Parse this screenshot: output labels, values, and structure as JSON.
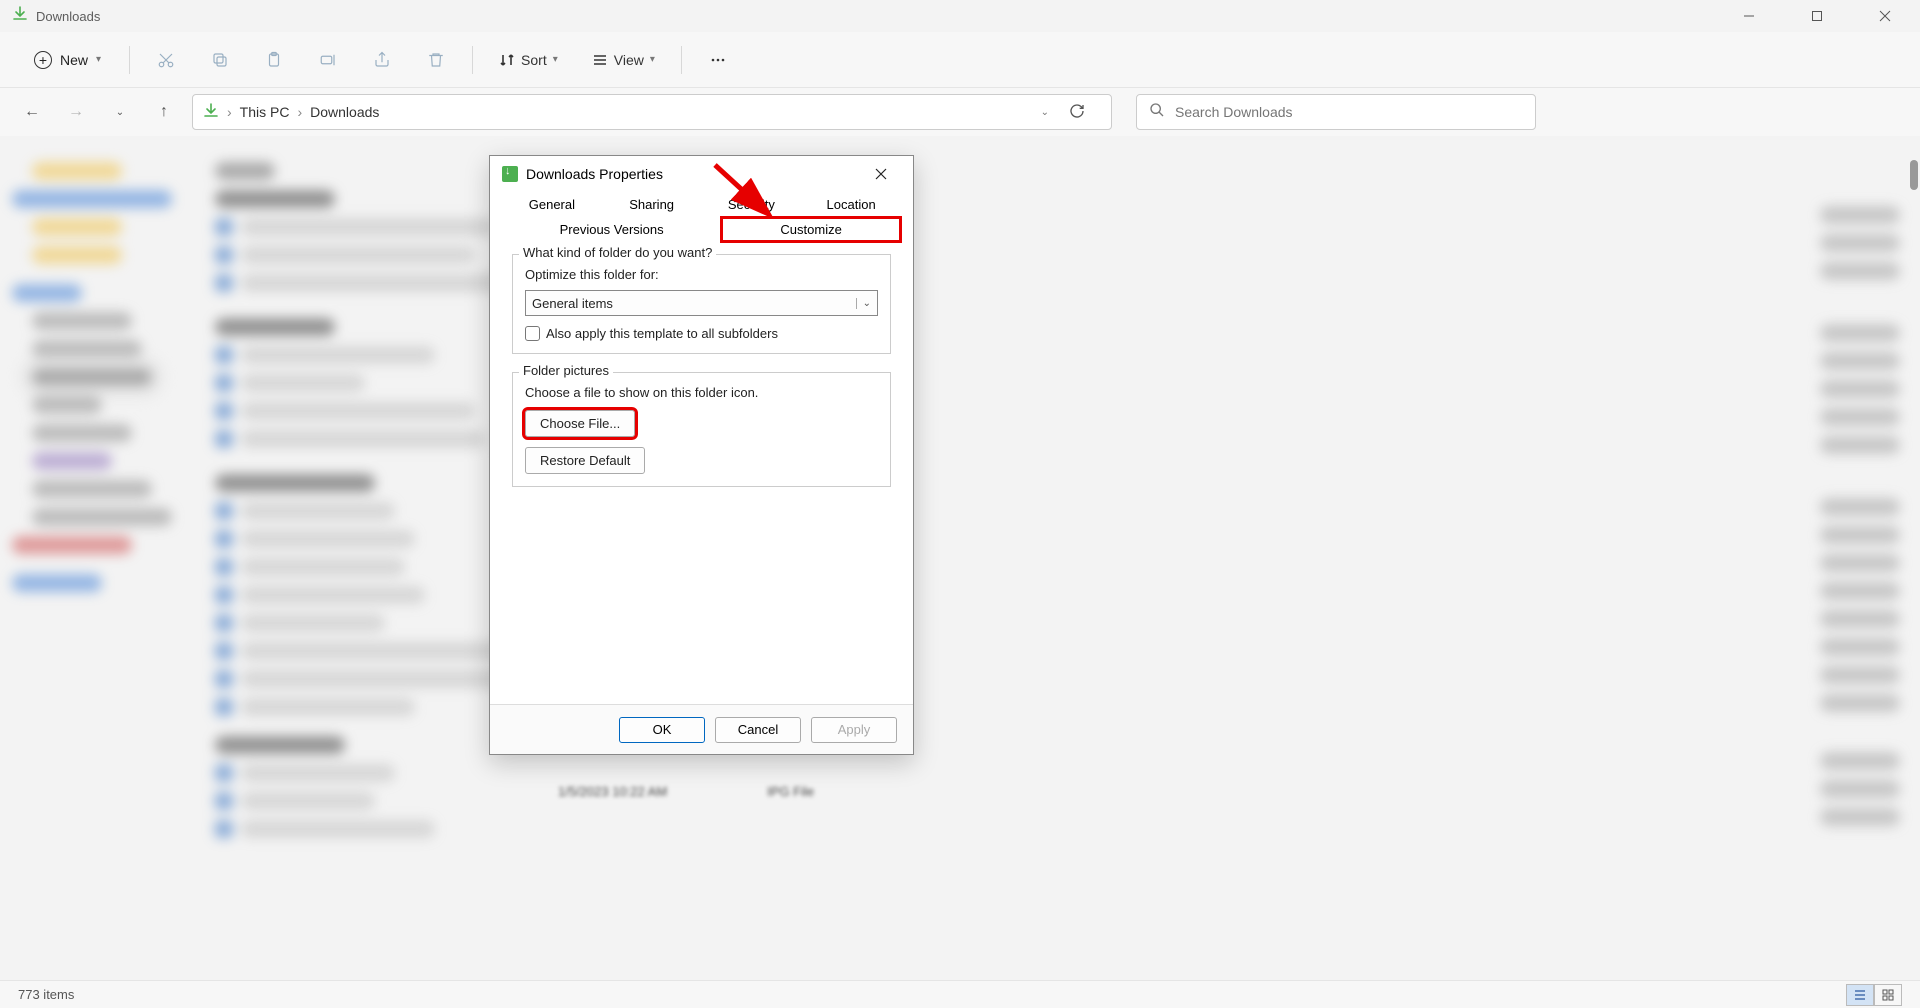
{
  "window": {
    "title": "Downloads"
  },
  "toolbar": {
    "new": "New",
    "sort": "Sort",
    "view": "View"
  },
  "breadcrumb": {
    "root": "This PC",
    "folder": "Downloads"
  },
  "search": {
    "placeholder": "Search Downloads"
  },
  "status": {
    "items": "773 items"
  },
  "dialog": {
    "title": "Downloads Properties",
    "tabs": {
      "general": "General",
      "sharing": "Sharing",
      "security": "Security",
      "location": "Location",
      "previous": "Previous Versions",
      "customize": "Customize"
    },
    "kind": {
      "heading": "What kind of folder do you want?",
      "optimize": "Optimize this folder for:",
      "selected": "General items",
      "apply_sub": "Also apply this template to all subfolders"
    },
    "pictures": {
      "heading": "Folder pictures",
      "desc": "Choose a file to show on this folder icon.",
      "choose": "Choose File...",
      "restore": "Restore Default"
    },
    "buttons": {
      "ok": "OK",
      "cancel": "Cancel",
      "apply": "Apply"
    }
  },
  "leak": {
    "date": "1/5/2023 10:22 AM",
    "type": "IPG File"
  }
}
